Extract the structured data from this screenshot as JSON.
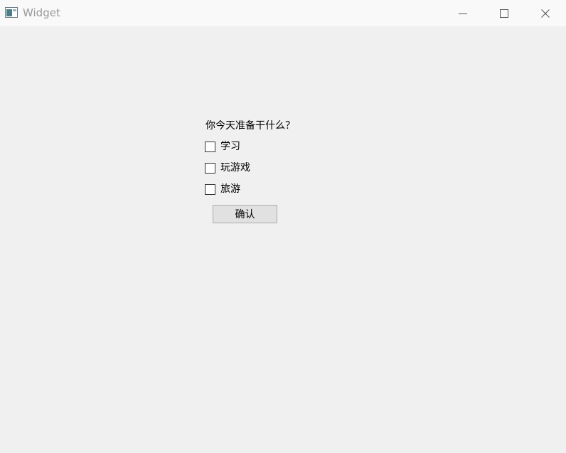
{
  "window": {
    "title": "Widget"
  },
  "form": {
    "question": "你今天准备干什么？",
    "options": [
      {
        "label": "学习",
        "checked": false
      },
      {
        "label": "玩游戏",
        "checked": false
      },
      {
        "label": "旅游",
        "checked": false
      }
    ],
    "confirm_label": "确认"
  }
}
